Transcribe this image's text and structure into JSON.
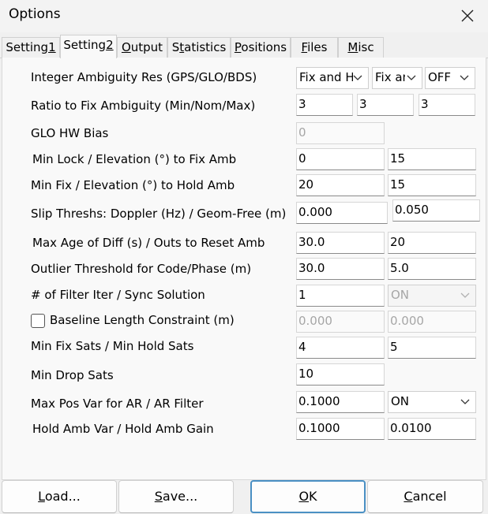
{
  "window": {
    "title": "Options"
  },
  "tabs": [
    {
      "pre": "Setting",
      "u": "1",
      "post": ""
    },
    {
      "pre": "Setting",
      "u": "2",
      "post": ""
    },
    {
      "pre": "",
      "u": "O",
      "post": "utput"
    },
    {
      "pre": "S",
      "u": "t",
      "post": "atistics"
    },
    {
      "pre": "",
      "u": "P",
      "post": "ositions"
    },
    {
      "pre": "",
      "u": "F",
      "post": "iles"
    },
    {
      "pre": "",
      "u": "M",
      "post": "isc"
    }
  ],
  "labels": {
    "ambiguity": "Integer Ambiguity Res (GPS/GLO/BDS)",
    "ratio": "Ratio to Fix Ambiguity (Min/Nom/Max)",
    "glo_bias": "GLO HW Bias",
    "min_lock": "Min Lock / Elevation (°) to Fix Amb",
    "min_fix": "Min Fix / Elevation (°) to Hold Amb",
    "slip": "Slip Threshs: Doppler (Hz) / Geom-Free (m)",
    "max_age": "Max Age of Diff (s) / Outs to Reset Amb",
    "outlier": "Outlier Threshold for Code/Phase (m)",
    "filter_iter": "# of Filter Iter / Sync Solution",
    "baseline": "Baseline Length Constraint (m)",
    "fix_sats": "Min Fix Sats / Min Hold Sats",
    "drop_sats": "Min Drop Sats",
    "pos_var": "Max Pos Var for AR / AR Filter",
    "hold_amb": "Hold Amb Var / Hold Amb Gain"
  },
  "values": {
    "amb_gps": "Fix and Hold",
    "amb_glo": "Fix and Hold",
    "amb_bds": "OFF",
    "ratio_min": "3",
    "ratio_nom": "3",
    "ratio_max": "3",
    "glo_bias": "0",
    "min_lock": "0",
    "min_lock_elev": "15",
    "min_fix": "20",
    "min_fix_elev": "15",
    "slip_doppler": "0.000",
    "slip_geom": "0.050",
    "max_age": "30.0",
    "outs_reset": "20",
    "outlier_code": "30.0",
    "outlier_phase": "5.0",
    "filter_iter": "1",
    "sync_solution": "ON",
    "baseline_1": "0.000",
    "baseline_2": "0.000",
    "fix_sats": "4",
    "hold_sats": "5",
    "drop_sats": "10",
    "pos_var": "0.1000",
    "ar_filter": "ON",
    "hold_amb_var": "0.1000",
    "hold_amb_gain": "0.0100"
  },
  "buttons": {
    "load": {
      "u": "L",
      "post": "oad..."
    },
    "save": {
      "u": "S",
      "post": "ave..."
    },
    "ok": {
      "u": "O",
      "post": "K"
    },
    "cancel": {
      "u": "C",
      "post": "ancel"
    }
  }
}
